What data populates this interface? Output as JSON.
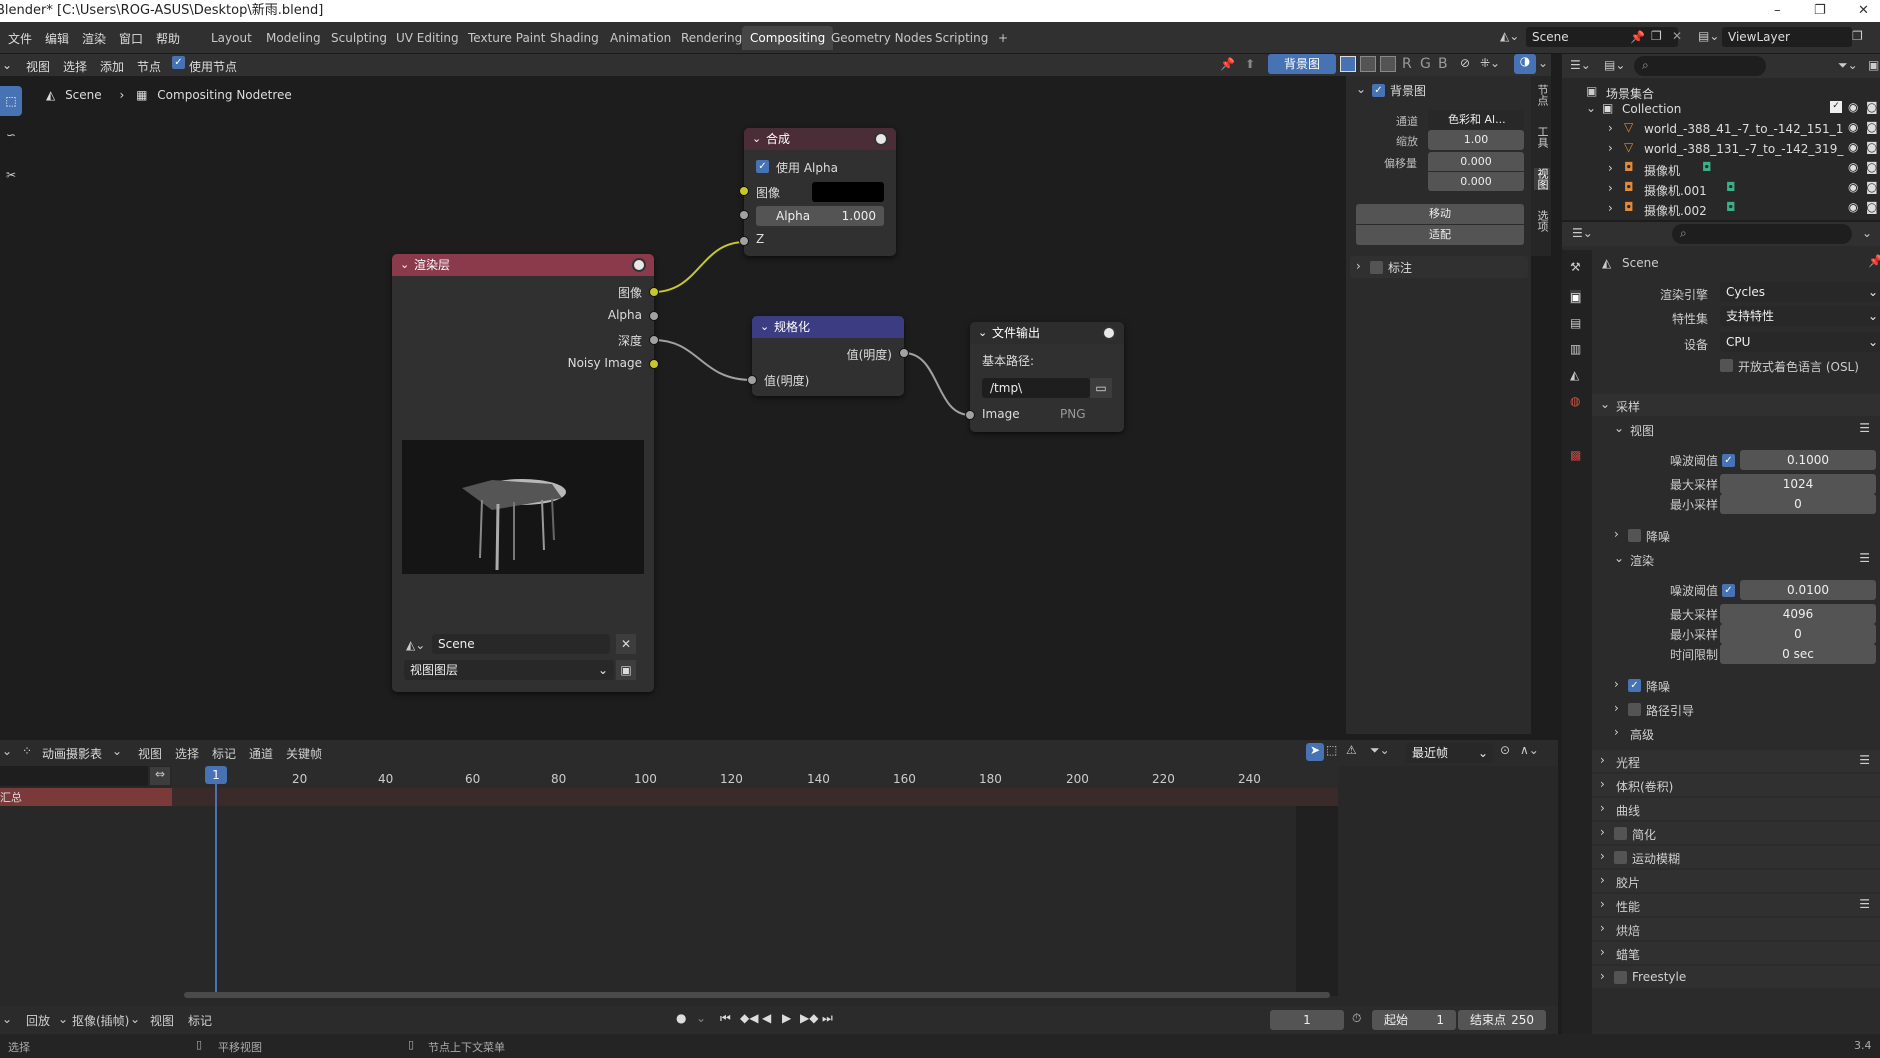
{
  "window": {
    "title": "Blender* [C:\\Users\\ROG-ASUS\\Desktop\\新雨.blend]",
    "controls": [
      "–",
      "❐",
      "✕"
    ]
  },
  "menu": [
    "文件",
    "编辑",
    "渲染",
    "窗口",
    "帮助"
  ],
  "workspaces": [
    "Layout",
    "Modeling",
    "Sculpting",
    "UV Editing",
    "Texture Paint",
    "Shading",
    "Animation",
    "Rendering",
    "Compositing",
    "Geometry Nodes",
    "Scripting",
    "+"
  ],
  "active_workspace": "Compositing",
  "scene_field": "Scene",
  "viewlayer_field": "ViewLayer",
  "node_editor": {
    "menus": [
      "视图",
      "选择",
      "添加",
      "节点"
    ],
    "use_nodes_label": "使用节点",
    "backdrop_button": "背景图",
    "channel_buttons": [
      "R",
      "G",
      "B"
    ],
    "breadcrumb": [
      "Scene",
      "Compositing Nodetree"
    ]
  },
  "nodes": {
    "composite": {
      "title": "合成",
      "use_alpha": "使用 Alpha",
      "image_label": "图像",
      "alpha_label": "Alpha",
      "alpha_value": "1.000",
      "z_label": "Z"
    },
    "render_layers": {
      "title": "渲染层",
      "outputs": [
        "图像",
        "Alpha",
        "深度",
        "Noisy Image"
      ],
      "scene": "Scene",
      "view_layer": "视图图层"
    },
    "normalize": {
      "title": "规格化",
      "output": "值(明度)",
      "input": "值(明度)"
    },
    "file_output": {
      "title": "文件输出",
      "base_path_label": "基本路径:",
      "base_path": "/tmp\\",
      "input_label": "Image",
      "format": "PNG"
    }
  },
  "backdrop_panel": {
    "title": "背景图",
    "channels_label": "通道",
    "channels_value": "色彩和 Al...",
    "zoom_label": "缩放",
    "zoom_value": "1.00",
    "offset_label": "偏移量",
    "offset_x": "0.000",
    "offset_y": "0.000",
    "move_button": "移动",
    "fit_button": "适配",
    "annotation": "标注"
  },
  "vertical_tabs": [
    "节点",
    "工具",
    "视图",
    "选项"
  ],
  "outliner": {
    "root": "场景集合",
    "items": [
      {
        "name": "Collection",
        "level": 0
      },
      {
        "name": "world_-388_41_-7_to_-142_151_1",
        "level": 1
      },
      {
        "name": "world_-388_131_-7_to_-142_319_",
        "level": 1
      },
      {
        "name": "摄像机",
        "level": 1
      },
      {
        "name": "摄像机.001",
        "level": 1
      },
      {
        "name": "摄像机.002",
        "level": 1
      }
    ]
  },
  "properties": {
    "scene": "Scene",
    "render_engine_label": "渲染引擎",
    "render_engine": "Cycles",
    "feature_set_label": "特性集",
    "feature_set": "支持特性",
    "device_label": "设备",
    "device": "CPU",
    "osl_label": "开放式着色语言 (OSL)",
    "sampling": "采样",
    "viewport": "视图",
    "noise_threshold_label": "噪波阈值",
    "viewport_noise_threshold": "0.1000",
    "max_samples_label": "最大采样",
    "viewport_max_samples": "1024",
    "min_samples_label": "最小采样",
    "viewport_min_samples": "0",
    "denoise": "降噪",
    "render": "渲染",
    "render_noise_threshold": "0.0100",
    "render_max_samples": "4096",
    "render_min_samples": "0",
    "time_limit_label": "时间限制",
    "time_limit": "0 sec",
    "path_guiding": "路径引导",
    "advanced": "高级",
    "sections": [
      "光程",
      "体积(卷积)",
      "曲线",
      "简化",
      "运动模糊",
      "胶片",
      "性能",
      "烘焙",
      "蜡笔",
      "Freestyle"
    ]
  },
  "timeline": {
    "editor_type": "动画摄影表",
    "menus": [
      "视图",
      "选择",
      "标记",
      "通道",
      "关键帧"
    ],
    "snap": "最近帧",
    "summary": "汇总",
    "current_frame": "1",
    "ticks": [
      "20",
      "40",
      "60",
      "80",
      "100",
      "120",
      "140",
      "160",
      "180",
      "200",
      "220",
      "240"
    ],
    "footer_menus": [
      "回放",
      "抠像(插帧)",
      "视图",
      "标记"
    ],
    "frame_field": "1",
    "start_label": "起始",
    "start_value": "1",
    "end_label": "结束点",
    "end_value": "250"
  },
  "status": {
    "select": "选择",
    "pan": "平移视图",
    "context": "节点上下文菜单",
    "version": "3.4"
  }
}
